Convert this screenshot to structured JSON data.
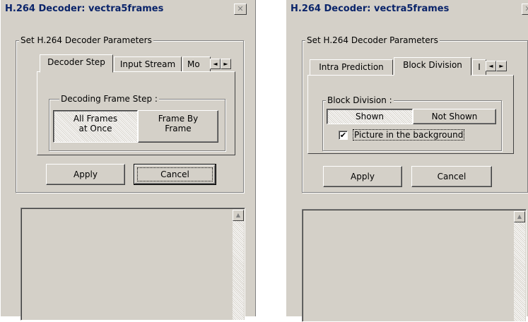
{
  "left_window": {
    "title": "H.264 Decoder: vectra5frames",
    "close_glyph": "✕",
    "params_group": "Set H.264 Decoder Parameters",
    "tabs": [
      "Decoder Step",
      "Input Stream",
      "Mo"
    ],
    "active_tab": "Decoder Step",
    "scroll_left_glyph": "◄",
    "scroll_right_glyph": "►",
    "step_group": "Decoding Frame Step :",
    "all_frames_line1": "All Frames",
    "all_frames_line2": "at Once",
    "frame_by_line1": "Frame By",
    "frame_by_line2": "Frame",
    "apply_label": "Apply",
    "cancel_label": "Cancel",
    "scroll_up_glyph": "▲"
  },
  "right_window": {
    "title": "H.264 Decoder: vectra5frames",
    "close_glyph": "✕",
    "params_group": "Set H.264 Decoder Parameters",
    "tabs": [
      "Intra Prediction",
      "Block Division",
      "I"
    ],
    "active_tab": "Block Division",
    "scroll_left_glyph": "◄",
    "scroll_right_glyph": "►",
    "block_group": "Block Division :",
    "shown_label": "Shown",
    "not_shown_label": "Not Shown",
    "checkbox_label": "Picture in the background",
    "checkbox_checked": true,
    "check_glyph": "✔",
    "apply_label": "Apply",
    "cancel_label": "Cancel",
    "scroll_up_glyph": "▲"
  }
}
